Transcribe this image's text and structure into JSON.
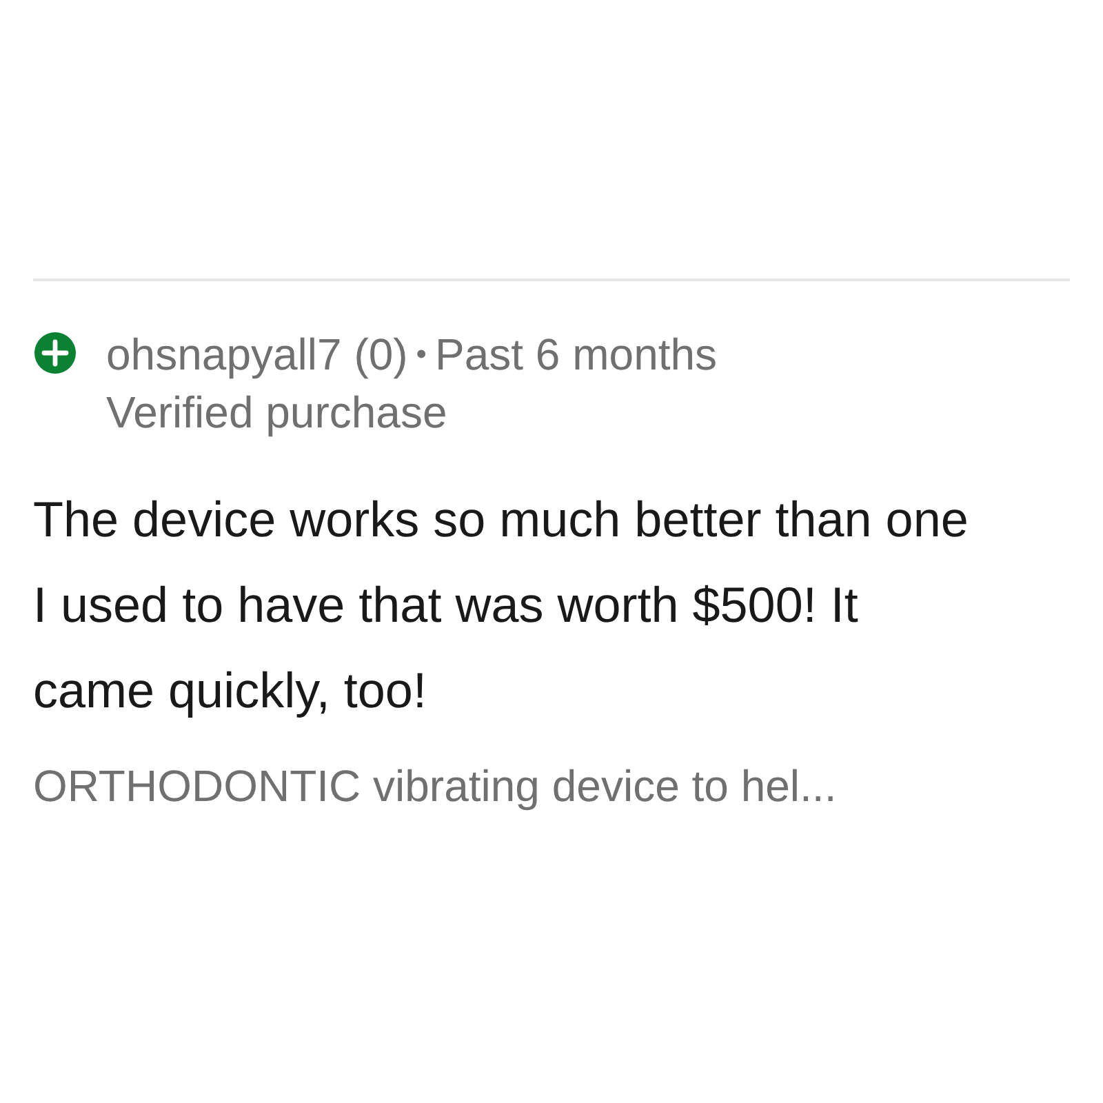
{
  "review": {
    "reviewer": "ohsnapyall7 (0)",
    "separator": "•",
    "date": "Past 6 months",
    "badge": "Verified purchase",
    "text": "The device works so much better than one I used to have that was worth $500! It came quickly, too!",
    "item_title": "ORTHODONTIC vibrating device to hel..."
  }
}
